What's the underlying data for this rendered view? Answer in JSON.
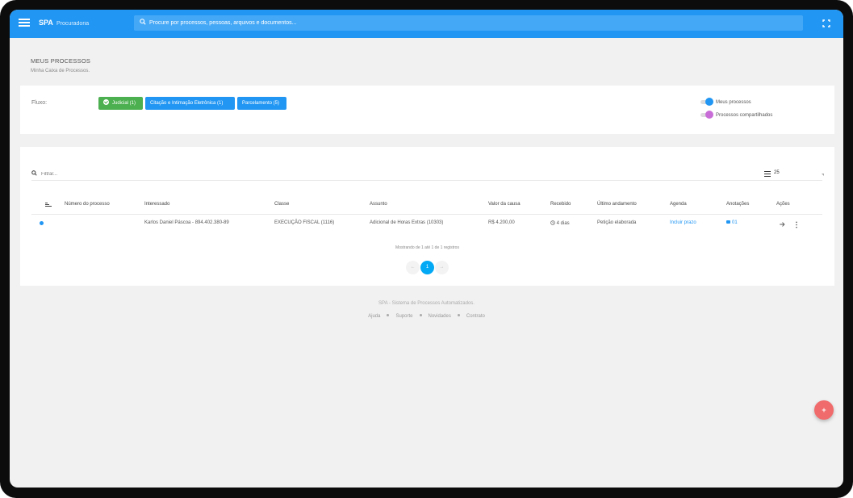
{
  "header": {
    "brand": "SPA",
    "brand_sub": "Procuradoria",
    "search_placeholder": "Procure por processos, pessoas, arquivos e documentos..."
  },
  "page": {
    "title": "MEUS PROCESSOS",
    "subtitle": "Minha Caixa de Processos."
  },
  "flow": {
    "label": "Fluxo:",
    "chips": [
      {
        "label": "Judicial (1)",
        "color": "#4caf50"
      },
      {
        "label": "Citação e Intimação Eletrônica (1)",
        "color": "#2196f3"
      },
      {
        "label": "Parcelamento (5)",
        "color": "#2196f3"
      }
    ],
    "toggles": [
      {
        "label": "Meus processos",
        "color": "#2196f3"
      },
      {
        "label": "Processos compartilhados",
        "color": "#c86dd7"
      }
    ]
  },
  "table": {
    "filter_placeholder": "Filtrar...",
    "page_size": "25",
    "columns": [
      "Número do processo",
      "Interessado",
      "Classe",
      "Assunto",
      "Valor da causa",
      "Recebido",
      "Último andamento",
      "Agenda",
      "Anotações",
      "Ações"
    ],
    "rows": [
      {
        "numero": "",
        "interessado": "Karlos Daniel Páscoa - 894.402.380-89",
        "classe": "EXECUÇÃO FISCAL (1116)",
        "assunto": "Adicional de Horas Extras (10303)",
        "valor": "R$ 4.200,00",
        "recebido": "4 dias",
        "andamento": "Petição elaborada",
        "agenda": "Incluir prazo",
        "anotacoes": "01"
      }
    ],
    "info": "Mostrando de 1 até 1 de 1 registros",
    "pagination": {
      "prev": "←",
      "current": "1",
      "next": "→"
    }
  },
  "footer": {
    "title": "SPA - Sistema de Processos Automatizados.",
    "links": [
      "Ajuda",
      "Suporte",
      "Novidades",
      "Contrato"
    ]
  },
  "fab_label": "+",
  "colors": {
    "primary": "#2196f3",
    "success": "#4caf50",
    "fab": "#f06b6b",
    "page_active": "#03a9f4"
  }
}
